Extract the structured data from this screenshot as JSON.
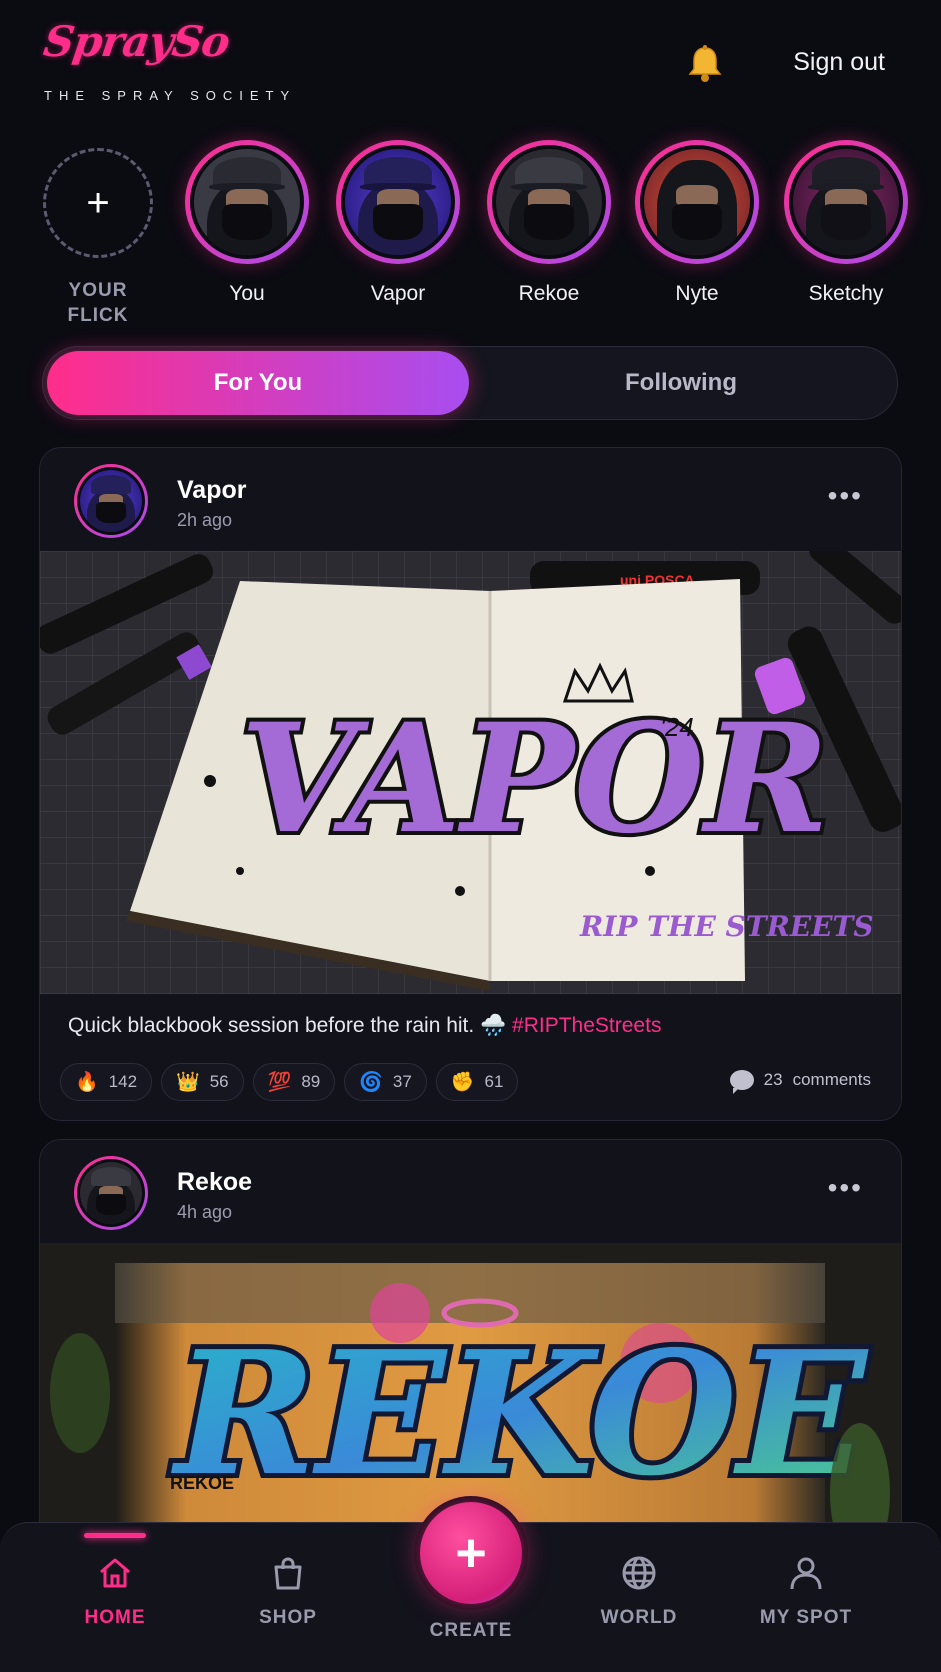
{
  "colors": {
    "accent": "#ff2d8a",
    "accent2": "#a84df0",
    "background": "#0b0b12"
  },
  "header": {
    "logo_script": "SpraySo",
    "logo_tagline": "THE SPRAY SOCIETY",
    "bell_icon": "bell-icon",
    "sign_out_label": "Sign out"
  },
  "stories": {
    "add_label_line1": "YOUR",
    "add_label_line2": "FLICK",
    "items": [
      {
        "label": "You"
      },
      {
        "label": "Vapor"
      },
      {
        "label": "Rekoe"
      },
      {
        "label": "Nyte"
      },
      {
        "label": "Sketchy"
      }
    ]
  },
  "feed_tabs": {
    "active": "For You",
    "inactive": "Following"
  },
  "posts": [
    {
      "user": "Vapor",
      "time": "2h ago",
      "caption": "Quick blackbook session before the rain hit. 🌧️",
      "hashtag": "#RIPTheStreets",
      "artwork_text": "VAPOR",
      "artwork_year": "'24",
      "artwork_tag": "RIP THE STREETS",
      "reactions": [
        {
          "emoji": "🔥",
          "count": "142"
        },
        {
          "emoji": "👑",
          "count": "56"
        },
        {
          "emoji": "💯",
          "count": "89"
        },
        {
          "emoji": "🌀",
          "count": "37"
        },
        {
          "emoji": "✊",
          "count": "61"
        }
      ],
      "comments_count": "23",
      "comments_label": "comments"
    },
    {
      "user": "Rekoe",
      "time": "4h ago",
      "artwork_text": "REKOE",
      "artwork_signature": "REKOE"
    }
  ],
  "nav": {
    "home": "HOME",
    "shop": "SHOP",
    "create": "CREATE",
    "world": "WORLD",
    "my_spot": "MY SPOT"
  }
}
